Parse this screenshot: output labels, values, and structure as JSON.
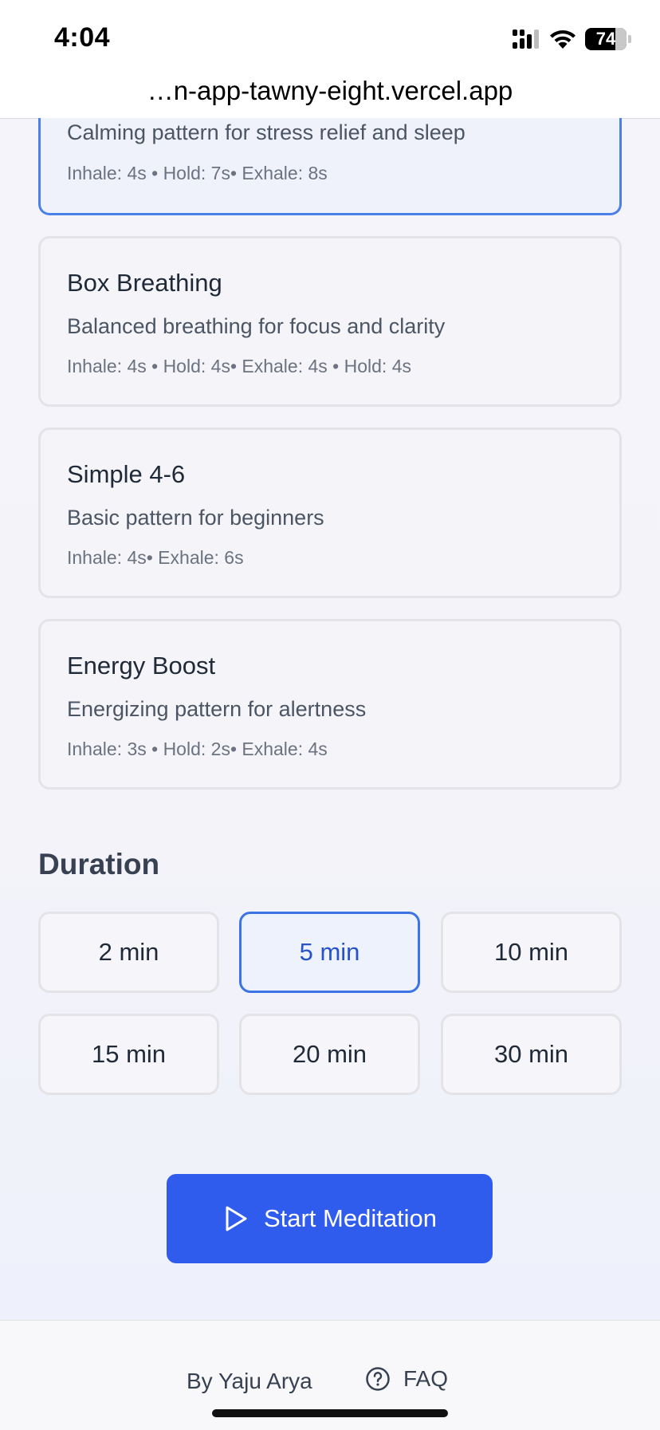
{
  "status_bar": {
    "time": "4:04",
    "battery": "74"
  },
  "browser": {
    "url": "…n-app-tawny-eight.vercel.app"
  },
  "patterns": [
    {
      "title": "",
      "description": "Calming pattern for stress relief and sleep",
      "timing": "Inhale: 4s • Hold: 7s• Exhale: 8s",
      "selected": true
    },
    {
      "title": "Box Breathing",
      "description": "Balanced breathing for focus and clarity",
      "timing": "Inhale: 4s • Hold: 4s• Exhale: 4s • Hold: 4s",
      "selected": false
    },
    {
      "title": "Simple 4-6",
      "description": "Basic pattern for beginners",
      "timing": "Inhale: 4s• Exhale: 6s",
      "selected": false
    },
    {
      "title": "Energy Boost",
      "description": "Energizing pattern for alertness",
      "timing": "Inhale: 3s • Hold: 2s• Exhale: 4s",
      "selected": false
    }
  ],
  "duration": {
    "title": "Duration",
    "options": [
      "2 min",
      "5 min",
      "10 min",
      "15 min",
      "20 min",
      "30 min"
    ],
    "selected": "5 min"
  },
  "start_button": {
    "label": "Start Meditation",
    "icon": "play-icon"
  },
  "footer": {
    "author": "By Yaju Arya",
    "faq_label": "FAQ",
    "faq_icon": "question-circle-icon"
  },
  "colors": {
    "accent": "#2f5ced",
    "selected_border": "#4b80e8",
    "selected_text": "#2752c9"
  }
}
